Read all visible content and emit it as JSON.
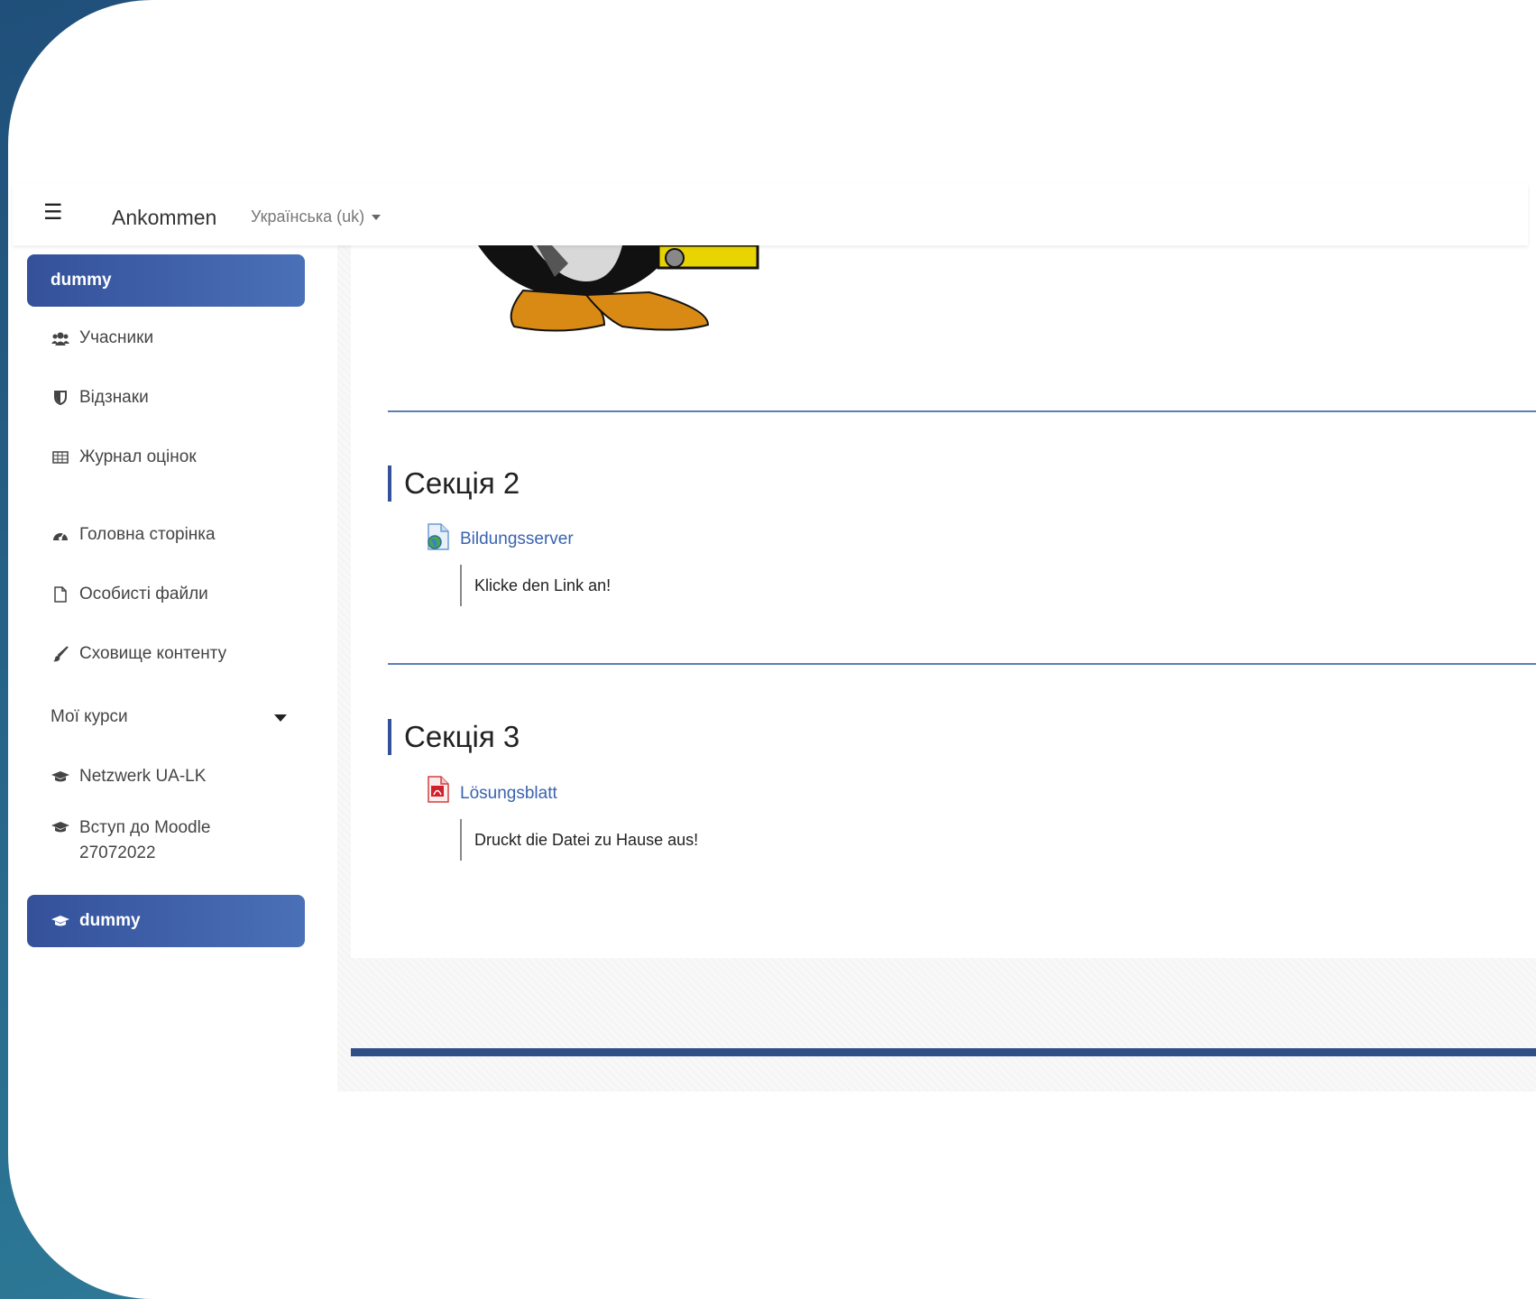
{
  "navbar": {
    "brand": "Ankommen",
    "language": "Українська (uk)"
  },
  "sidebar": {
    "items": [
      {
        "label": "dummy",
        "icon": "none",
        "active": true
      },
      {
        "label": "Учасники",
        "icon": "users-icon"
      },
      {
        "label": "Відзнаки",
        "icon": "shield-icon"
      },
      {
        "label": "Журнал оцінок",
        "icon": "table-icon"
      },
      {
        "label": "Головна сторінка",
        "icon": "dashboard-icon"
      },
      {
        "label": "Особисті файли",
        "icon": "file-icon"
      },
      {
        "label": "Сховище контенту",
        "icon": "brush-icon"
      },
      {
        "label": "Мої курси",
        "icon": "none"
      },
      {
        "label": "Netzwerk UA-LK",
        "icon": "graduation-cap-icon"
      },
      {
        "label": "Вступ до Moodle",
        "label2": "27072022",
        "icon": "graduation-cap-icon"
      },
      {
        "label": "dummy",
        "icon": "graduation-cap-icon",
        "active": true
      }
    ]
  },
  "sections": [
    {
      "title": "Секція 2",
      "module": {
        "name": "Bildungsserver",
        "icon": "url-icon",
        "description": "Klicke den Link an!"
      }
    },
    {
      "title": "Секція 3",
      "module": {
        "name": "Lösungsblatt",
        "icon": "pdf-icon",
        "description": "Druckt die Datei zu Hause aus!"
      }
    }
  ],
  "colors": {
    "accent": "#34519a",
    "link": "#3a63b0",
    "footer": "#2f4f87"
  }
}
